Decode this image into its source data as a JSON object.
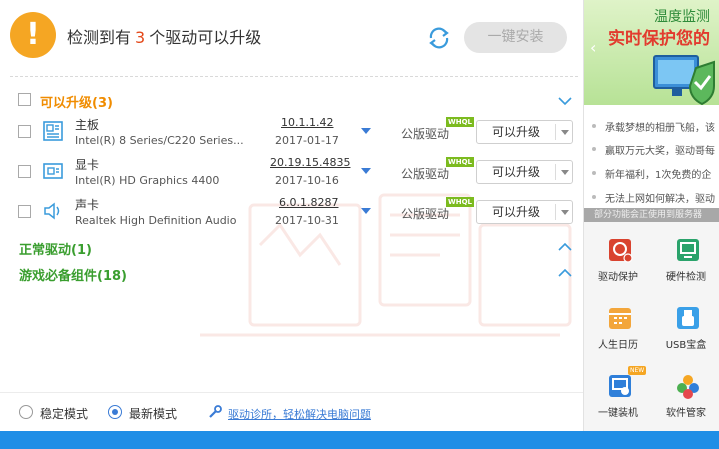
{
  "header": {
    "headline_pre": "检测到有",
    "headline_count": "3",
    "headline_post": "个驱动可以升级",
    "onekey_install": "一键安装"
  },
  "sections": {
    "upgradable": "可以升级(3)",
    "normal": "正常驱动(1)",
    "game": "游戏必备组件(18)"
  },
  "drivers": [
    {
      "icon": "motherboard-icon",
      "name": "主板",
      "model": "Intel(R) 8 Series/C220 Series...",
      "version": "10.1.1.42",
      "date": "2017-01-17",
      "type": "公版驱动",
      "badge": "WHQL",
      "action": "可以升级"
    },
    {
      "icon": "graphics-card-icon",
      "name": "显卡",
      "model": "Intel(R) HD Graphics 4400",
      "version": "20.19.15.4835",
      "date": "2017-10-16",
      "type": "公版驱动",
      "badge": "WHQL",
      "action": "可以升级"
    },
    {
      "icon": "speaker-icon",
      "name": "声卡",
      "model": "Realtek High Definition Audio",
      "version": "6.0.1.8287",
      "date": "2017-10-31",
      "type": "公版驱动",
      "badge": "WHQL",
      "action": "可以升级"
    }
  ],
  "footer": {
    "mode_stable": "稳定模式",
    "mode_latest": "最新模式",
    "selected_mode": "最新模式",
    "diagnose_link": "驱动诊所，轻松解决电脑问题"
  },
  "side": {
    "banner_line1": "温度监测",
    "banner_line2": "实时保护您的",
    "news": [
      "承载梦想的相册飞船，该",
      "赢取万元大奖，驱动哥每",
      "新年福利，1次免费的企",
      "无法上网如何解决，驱动"
    ],
    "ad_strip": "部分功能会正使用到服务器",
    "tools": [
      {
        "icon": "driver-protect-icon",
        "label": "驱动保护"
      },
      {
        "icon": "hardware-check-icon",
        "label": "硬件检测"
      },
      {
        "icon": "calendar-icon",
        "label": "人生日历"
      },
      {
        "icon": "usb-icon",
        "label": "USB宝盒"
      },
      {
        "icon": "one-click-install-icon",
        "label": "一键装机",
        "badge": "NEW"
      },
      {
        "icon": "software-manager-icon",
        "label": "软件管家"
      }
    ]
  },
  "colors": {
    "accent_blue": "#1f8ee6",
    "warning_orange": "#f5a623",
    "section_orange": "#f08c00",
    "section_green": "#3a9e2f",
    "count_red": "#e4491a"
  }
}
